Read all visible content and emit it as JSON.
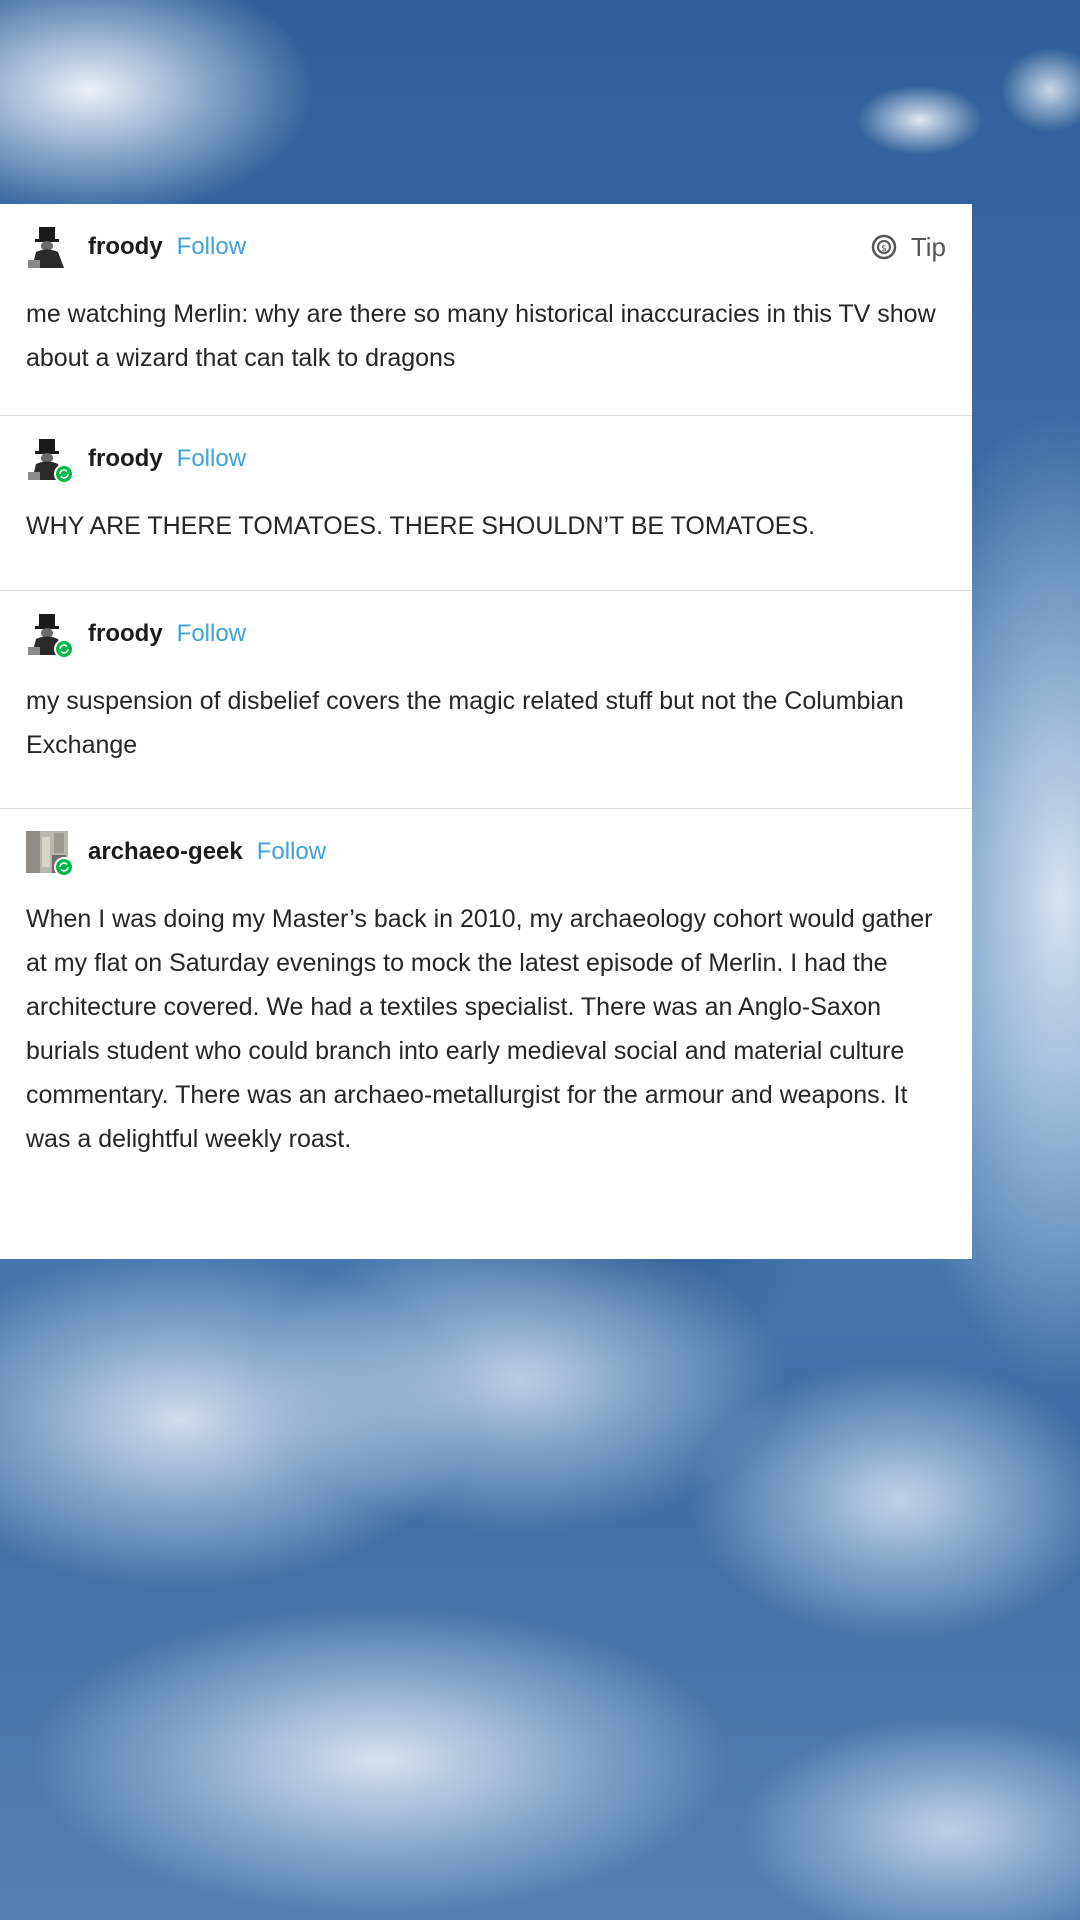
{
  "posts": [
    {
      "username": "froody",
      "follow_label": "Follow",
      "tip_label": "Tip",
      "avatar_icon": "top-hat-figure-avatar",
      "reblogged": false,
      "text": "me watching Merlin: why are there so many historical inaccuracies in this TV show about a wizard that can talk to dragons"
    },
    {
      "username": "froody",
      "follow_label": "Follow",
      "avatar_icon": "top-hat-figure-avatar",
      "reblogged": true,
      "text": "WHY ARE THERE TOMATOES. THERE SHOULDN’T BE TOMATOES."
    },
    {
      "username": "froody",
      "follow_label": "Follow",
      "avatar_icon": "top-hat-figure-avatar",
      "reblogged": true,
      "text": "my suspension of disbelief covers the magic related stuff but not the Columbian Exchange"
    },
    {
      "username": "archaeo-geek",
      "follow_label": "Follow",
      "avatar_icon": "photo-avatar",
      "reblogged": true,
      "text": "When I was doing my Master’s back in 2010, my archaeology cohort would gather at my flat on Saturday evenings to mock the latest episode of Merlin. I had the architecture covered. We had a textiles specialist. There was an Anglo-Saxon burials student who could branch into early medieval social and material culture commentary. There was an archaeo-metallurgist for the armour and weapons. It was a delightful weekly roast."
    }
  ],
  "colors": {
    "follow": "#3ea3d9",
    "reblog_badge": "#00b84a",
    "card_background": "#ffffff",
    "sky": "#3b6ea8"
  }
}
